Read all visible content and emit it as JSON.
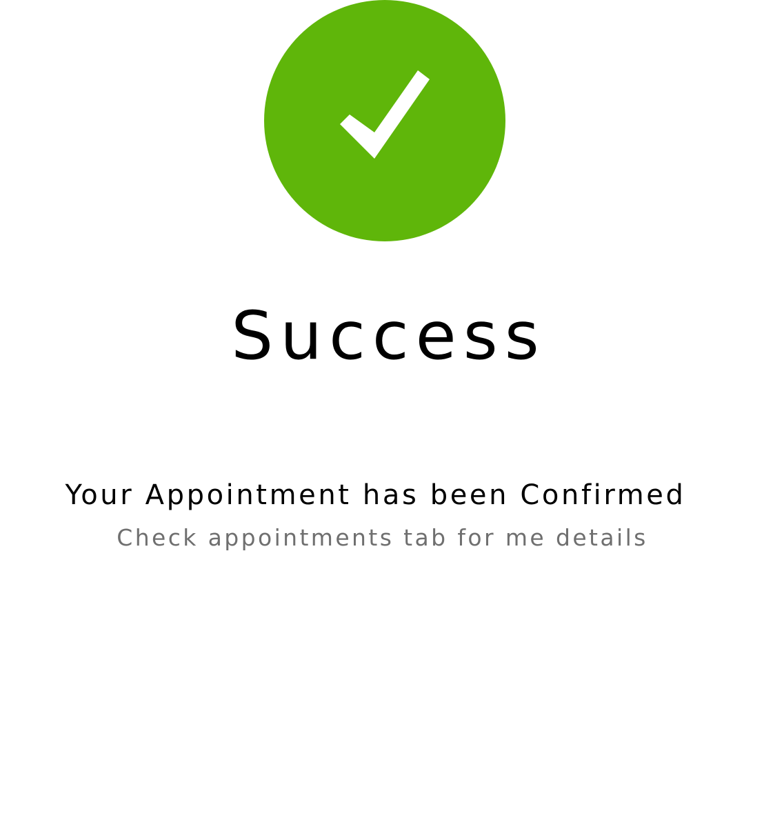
{
  "colors": {
    "success_green": "#5fb60a",
    "title_text": "#000000",
    "subtext": "#6f6f6f",
    "background": "#ffffff"
  },
  "icon": {
    "name": "checkmark-icon"
  },
  "title": "Success",
  "message": {
    "heading": "Your Appointment has been Confirmed",
    "subtext": "Check appointments tab for me details"
  }
}
